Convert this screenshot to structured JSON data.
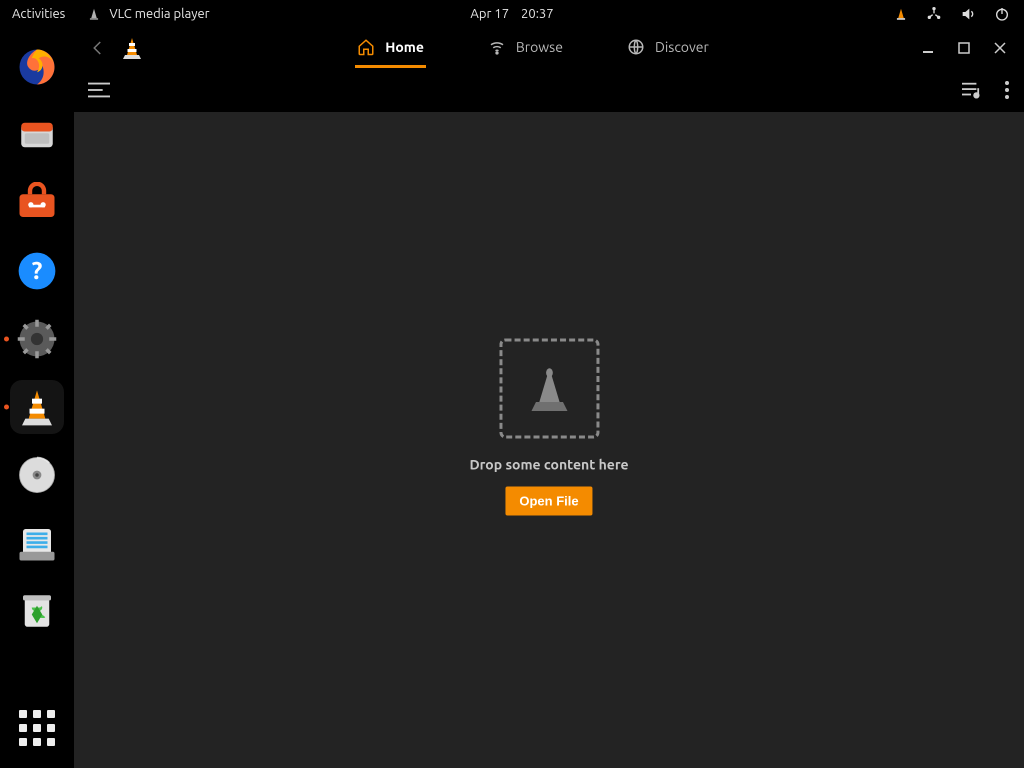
{
  "topbar": {
    "activities": "Activities",
    "app_name": "VLC media player",
    "date": "Apr 17",
    "time": "20:37"
  },
  "dock": {
    "items": [
      {
        "name": "firefox"
      },
      {
        "name": "files"
      },
      {
        "name": "software"
      },
      {
        "name": "help"
      },
      {
        "name": "settings",
        "running": true
      },
      {
        "name": "vlc",
        "running": true,
        "active": true
      },
      {
        "name": "disk"
      },
      {
        "name": "scanner"
      },
      {
        "name": "trash"
      }
    ]
  },
  "vlc": {
    "nav": {
      "home": "Home",
      "browse": "Browse",
      "discover": "Discover"
    },
    "drop_text": "Drop some content here",
    "open_file_label": "Open File"
  }
}
